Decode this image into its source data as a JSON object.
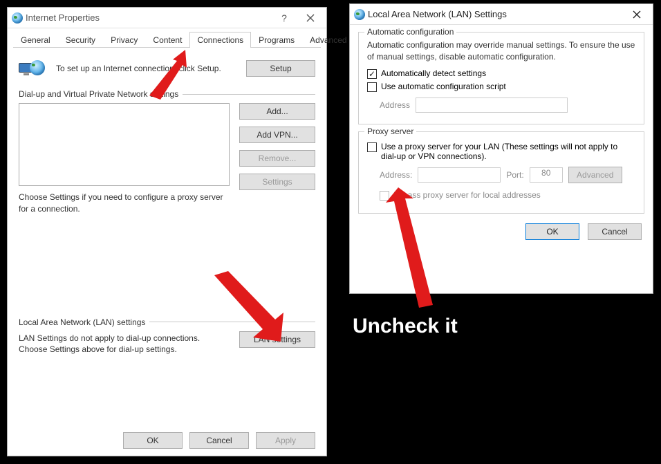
{
  "ip": {
    "title": "Internet Properties",
    "tabs": [
      "General",
      "Security",
      "Privacy",
      "Content",
      "Connections",
      "Programs",
      "Advanced"
    ],
    "active_tab": "Connections",
    "setup_text": "To set up an Internet connection, click Setup.",
    "setup_btn": "Setup",
    "dial_group": "Dial-up and Virtual Private Network settings",
    "buttons": {
      "add": "Add...",
      "add_vpn": "Add VPN...",
      "remove": "Remove...",
      "settings": "Settings"
    },
    "dial_note": "Choose Settings if you need to configure a proxy server for a connection.",
    "lan_group": "Local Area Network (LAN) settings",
    "lan_note": "LAN Settings do not apply to dial-up connections. Choose Settings above for dial-up settings.",
    "lan_btn": "LAN settings",
    "ok": "OK",
    "cancel": "Cancel",
    "apply": "Apply"
  },
  "lan": {
    "title": "Local Area Network (LAN) Settings",
    "auto_group": "Automatic configuration",
    "auto_text": "Automatic configuration may override manual settings.  To ensure the use of manual settings, disable automatic configuration.",
    "cb_auto_detect": "Automatically detect settings",
    "cb_auto_script": "Use automatic configuration script",
    "addr_label": "Address",
    "proxy_group": "Proxy server",
    "cb_proxy": "Use a proxy server for your LAN (These settings will not apply to dial-up or VPN connections).",
    "proxy_addr_label": "Address:",
    "proxy_port_label": "Port:",
    "proxy_port_value": "80",
    "advanced": "Advanced",
    "cb_bypass": "Bypass proxy server for local addresses",
    "ok": "OK",
    "cancel": "Cancel"
  },
  "annotation": "Uncheck it"
}
